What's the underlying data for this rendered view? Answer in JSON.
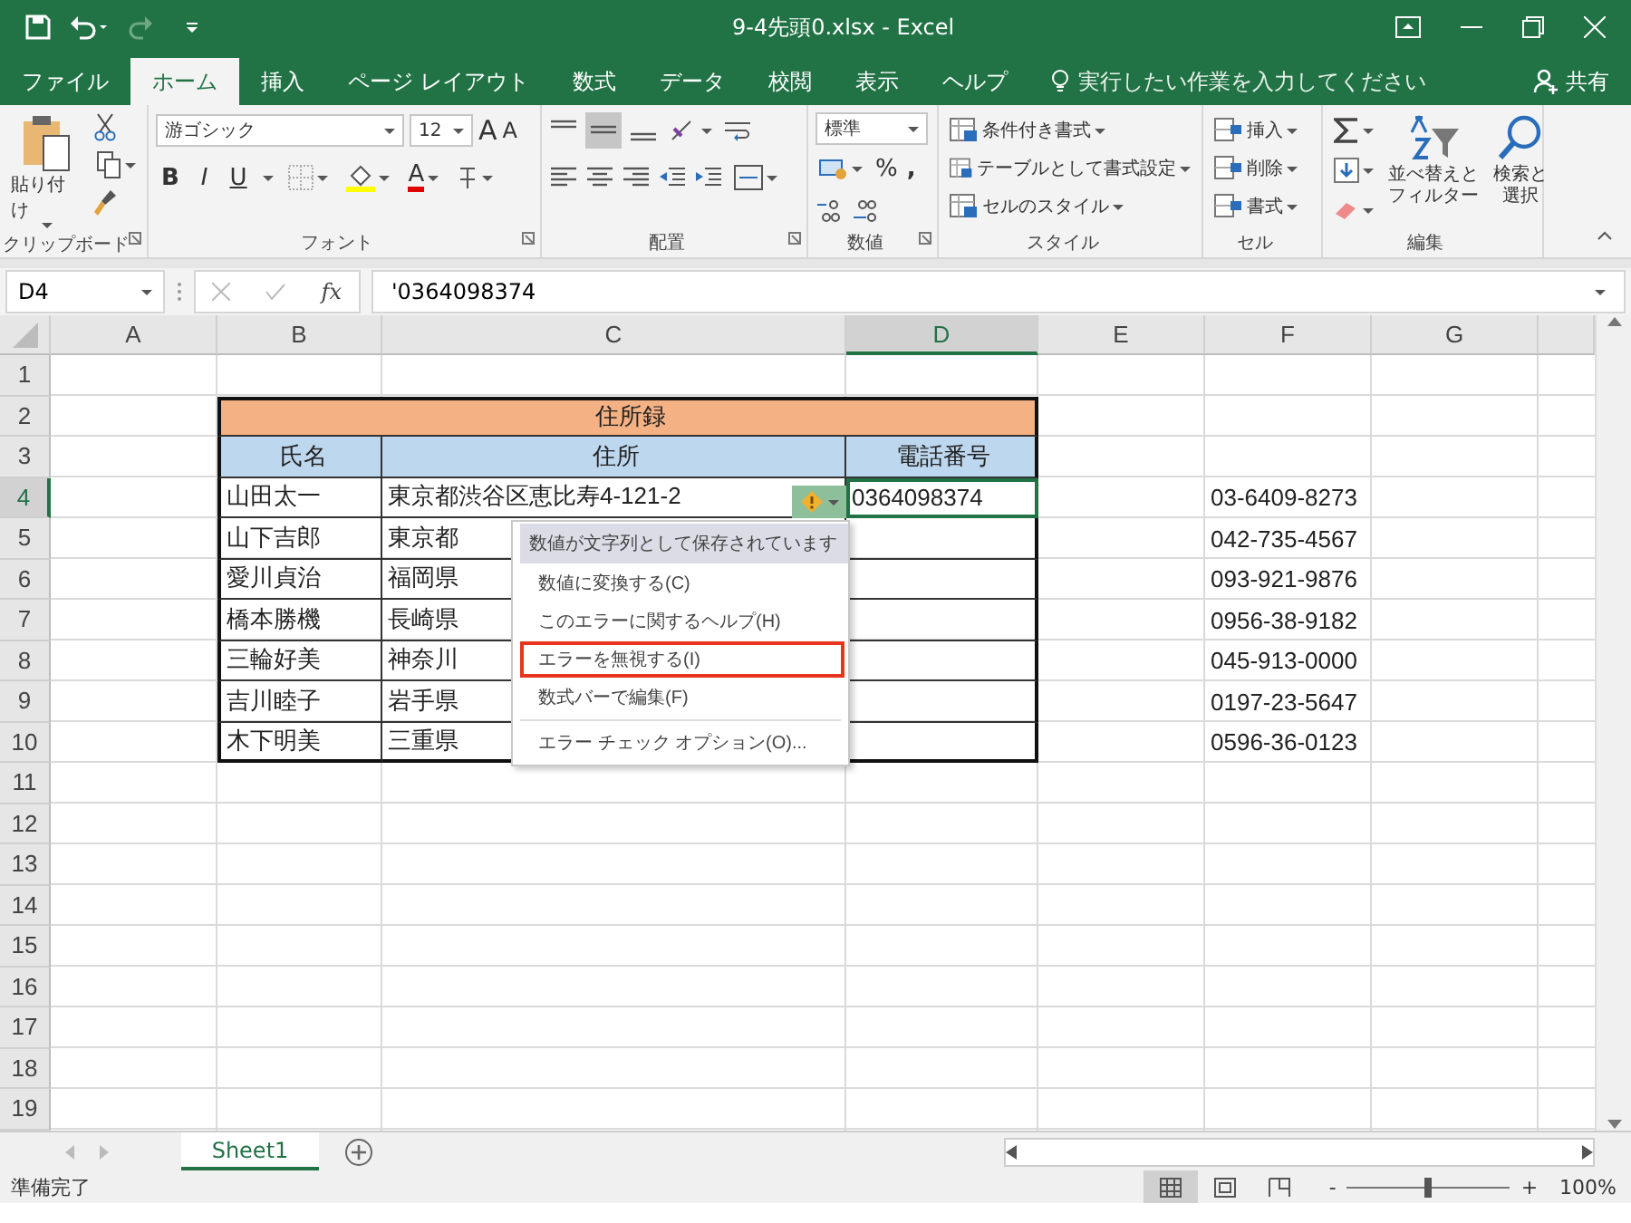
{
  "title_bar": {
    "title": "9-4先頭0.xlsx - Excel"
  },
  "ribbon_tabs": [
    {
      "label": "ファイル",
      "selected": false
    },
    {
      "label": "ホーム",
      "selected": true
    },
    {
      "label": "挿入",
      "selected": false
    },
    {
      "label": "ページ レイアウト",
      "selected": false
    },
    {
      "label": "数式",
      "selected": false
    },
    {
      "label": "データ",
      "selected": false
    },
    {
      "label": "校閲",
      "selected": false
    },
    {
      "label": "表示",
      "selected": false
    },
    {
      "label": "ヘルプ",
      "selected": false
    }
  ],
  "tell_me": {
    "placeholder": "実行したい作業を入力してください"
  },
  "share_button": "共有",
  "ribbon": {
    "clipboard": {
      "paste": "貼り付け",
      "label": "クリップボード"
    },
    "font": {
      "font_name": "游ゴシック",
      "font_size": "12",
      "grow": "A",
      "shrink": "A",
      "bold": "B",
      "italic": "I",
      "underline": "U",
      "font_color": "A",
      "label": "フォント"
    },
    "alignment": {
      "label": "配置"
    },
    "number": {
      "format": "標準",
      "percent": "%",
      "comma": ",",
      "label": "数値"
    },
    "styles": {
      "items": [
        "条件付き書式",
        "テーブルとして書式設定",
        "セルのスタイル"
      ],
      "label": "スタイル"
    },
    "cells": {
      "items": [
        "挿入",
        "削除",
        "書式"
      ],
      "label": "セル"
    },
    "editing": {
      "sort_lines": [
        "並べ替えと",
        "フィルター"
      ],
      "find_lines": [
        "検索と",
        "選択"
      ],
      "label": "編集"
    }
  },
  "formula_bar": {
    "name_box": "D4",
    "function_label": "fx",
    "formula": "'0364098374"
  },
  "columns": [
    {
      "label": "A",
      "selected": false
    },
    {
      "label": "B",
      "selected": false
    },
    {
      "label": "C",
      "selected": false
    },
    {
      "label": "D",
      "selected": true
    },
    {
      "label": "E",
      "selected": false
    },
    {
      "label": "F",
      "selected": false
    },
    {
      "label": "G",
      "selected": false
    }
  ],
  "rows": [
    {
      "label": "1",
      "selected": false
    },
    {
      "label": "2",
      "selected": false
    },
    {
      "label": "3",
      "selected": false
    },
    {
      "label": "4",
      "selected": true
    },
    {
      "label": "5",
      "selected": false
    },
    {
      "label": "6",
      "selected": false
    },
    {
      "label": "7",
      "selected": false
    },
    {
      "label": "8",
      "selected": false
    },
    {
      "label": "9",
      "selected": false
    },
    {
      "label": "10",
      "selected": false
    },
    {
      "label": "11",
      "selected": false
    },
    {
      "label": "12",
      "selected": false
    },
    {
      "label": "13",
      "selected": false
    },
    {
      "label": "14",
      "selected": false
    },
    {
      "label": "15",
      "selected": false
    },
    {
      "label": "16",
      "selected": false
    },
    {
      "label": "17",
      "selected": false
    },
    {
      "label": "18",
      "selected": false
    },
    {
      "label": "19",
      "selected": false
    }
  ],
  "sheet": {
    "title": "住所録",
    "headers": [
      "氏名",
      "住所",
      "電話番号"
    ],
    "records": [
      {
        "name": "山田太一",
        "address": "東京都渋谷区恵比寿4-121-2",
        "phone": "0364098374"
      },
      {
        "name": "山下吉郎",
        "address": "東京都"
      },
      {
        "name": "愛川貞治",
        "address": "福岡県"
      },
      {
        "name": "橋本勝機",
        "address": "長崎県"
      },
      {
        "name": "三輪好美",
        "address": "神奈川"
      },
      {
        "name": "吉川睦子",
        "address": "岩手県"
      },
      {
        "name": "木下明美",
        "address": "三重県"
      }
    ]
  },
  "phone_column": [
    "03-6409-8273",
    "042-735-4567",
    "093-921-9876",
    "0956-38-9182",
    "045-913-0000",
    "0197-23-5647",
    "0596-36-0123"
  ],
  "error_menu": {
    "title": "数値が文字列として保存されています",
    "items": [
      {
        "label": "数値に変換する(C)",
        "selected": false
      },
      {
        "label": "このエラーに関するヘルプ(H)",
        "selected": false
      },
      {
        "label": "エラーを無視する(I)",
        "selected": true
      },
      {
        "label": "数式バーで編集(F)",
        "selected": false
      },
      {
        "label": "エラー チェック オプション(O)...",
        "selected": false
      }
    ]
  },
  "sheet_tabs": [
    {
      "label": "Sheet1",
      "selected": true
    }
  ],
  "status_bar": {
    "status": "準備完了",
    "views": [
      {
        "selected": true
      },
      {
        "selected": false
      },
      {
        "selected": false
      }
    ],
    "zoom_out": "-",
    "zoom_in": "+",
    "zoom": {
      "level": 0.5,
      "reading": "100%"
    }
  }
}
